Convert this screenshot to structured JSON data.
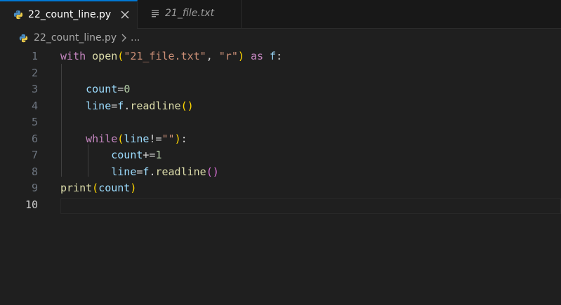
{
  "tabs": [
    {
      "label": "22_count_line.py",
      "active": true
    },
    {
      "label": "21_file.txt",
      "active": false
    }
  ],
  "breadcrumb": {
    "file": "22_count_line.py",
    "more": "..."
  },
  "editor": {
    "current_line": 10,
    "lines": [
      {
        "n": "1",
        "tokens": [
          [
            "with",
            "kw-ctrl"
          ],
          [
            " ",
            "plain"
          ],
          [
            "open",
            "fn"
          ],
          [
            "(",
            "p1"
          ],
          [
            "\"21_file.txt\"",
            "str"
          ],
          [
            ", ",
            "plain"
          ],
          [
            "\"r\"",
            "str"
          ],
          [
            ")",
            "p1"
          ],
          [
            " ",
            "plain"
          ],
          [
            "as",
            "kw-ctrl"
          ],
          [
            " ",
            "plain"
          ],
          [
            "f",
            "var"
          ],
          [
            ":",
            "plain"
          ]
        ]
      },
      {
        "n": "2",
        "tokens": []
      },
      {
        "n": "3",
        "tokens": [
          [
            "    ",
            "plain"
          ],
          [
            "count",
            "var"
          ],
          [
            "=",
            "plain"
          ],
          [
            "0",
            "num"
          ]
        ]
      },
      {
        "n": "4",
        "tokens": [
          [
            "    ",
            "plain"
          ],
          [
            "line",
            "var"
          ],
          [
            "=",
            "plain"
          ],
          [
            "f",
            "var"
          ],
          [
            ".",
            "plain"
          ],
          [
            "readline",
            "fn"
          ],
          [
            "()",
            "p1"
          ]
        ]
      },
      {
        "n": "5",
        "tokens": []
      },
      {
        "n": "6",
        "tokens": [
          [
            "    ",
            "plain"
          ],
          [
            "while",
            "kw-ctrl"
          ],
          [
            "(",
            "p1"
          ],
          [
            "line",
            "var"
          ],
          [
            "!=",
            "plain"
          ],
          [
            "\"\"",
            "str"
          ],
          [
            ")",
            "p1"
          ],
          [
            ":",
            "plain"
          ]
        ]
      },
      {
        "n": "7",
        "tokens": [
          [
            "        ",
            "plain"
          ],
          [
            "count",
            "var"
          ],
          [
            "+=",
            "plain"
          ],
          [
            "1",
            "num"
          ]
        ]
      },
      {
        "n": "8",
        "tokens": [
          [
            "        ",
            "plain"
          ],
          [
            "line",
            "var"
          ],
          [
            "=",
            "plain"
          ],
          [
            "f",
            "var"
          ],
          [
            ".",
            "plain"
          ],
          [
            "readline",
            "fn"
          ],
          [
            "()",
            "p2"
          ]
        ]
      },
      {
        "n": "9",
        "tokens": [
          [
            "print",
            "fn"
          ],
          [
            "(",
            "p1"
          ],
          [
            "count",
            "var"
          ],
          [
            ")",
            "p1"
          ]
        ]
      },
      {
        "n": "10",
        "tokens": []
      }
    ]
  }
}
